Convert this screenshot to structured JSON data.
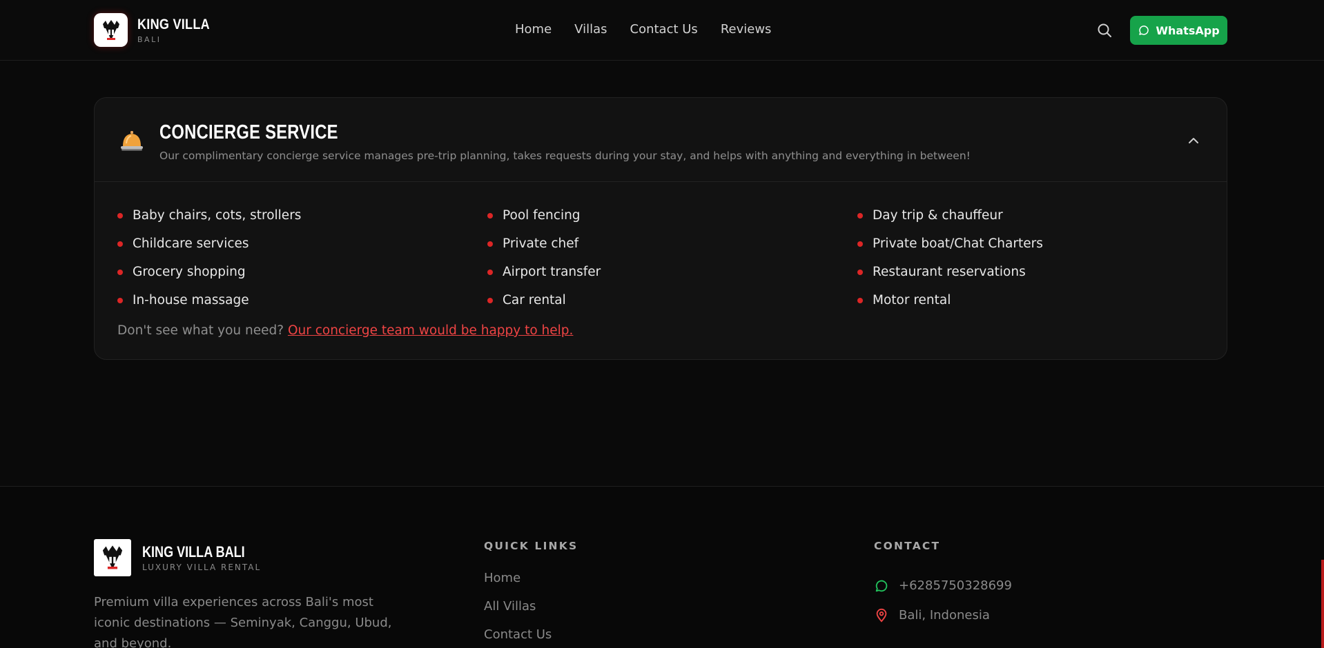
{
  "header": {
    "brand_name": "KING VILLA",
    "brand_sub": "BALI",
    "nav": [
      "Home",
      "Villas",
      "Contact Us",
      "Reviews"
    ],
    "whatsapp_label": "WhatsApp"
  },
  "concierge": {
    "title": "CONCIERGE SERVICE",
    "description": "Our complimentary concierge service manages pre-trip planning, takes requests during your stay, and helps with anything and everything in between!",
    "columns": [
      [
        "Baby chairs, cots, strollers",
        "Childcare services",
        "Grocery shopping",
        "In-house massage"
      ],
      [
        "Pool fencing",
        "Private chef",
        "Airport transfer",
        "Car rental"
      ],
      [
        "Day trip & chauffeur",
        "Private boat/Chat Charters",
        "Restaurant reservations",
        "Motor rental"
      ]
    ],
    "help_question": "Don't see what you need?",
    "help_link": "Our concierge team would be happy to help."
  },
  "footer": {
    "brand_name": "KING VILLA BALI",
    "brand_sub": "LUXURY VILLA RENTAL",
    "description": "Premium villa experiences across Bali's most iconic destinations — Seminyak, Canggu, Ubud, and beyond.",
    "quick_links_title": "QUICK LINKS",
    "quick_links": [
      "Home",
      "All Villas",
      "Contact Us"
    ],
    "contact_title": "CONTACT",
    "phone": "+6285750328699",
    "location": "Bali, Indonesia"
  },
  "colors": {
    "accent": "#dc2626",
    "whatsapp": "#16a34a",
    "background": "#0a0a0a"
  }
}
